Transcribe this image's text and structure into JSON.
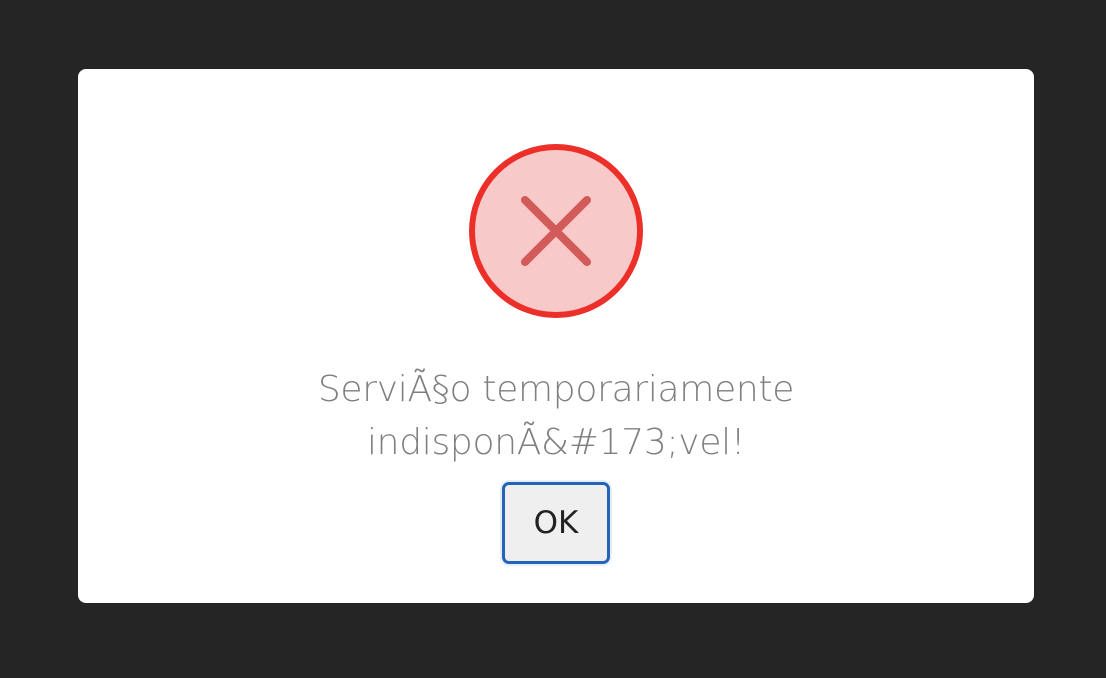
{
  "dialog": {
    "icon": "error-x-circle-icon",
    "message_line1": "ServiÃ§o temporariamente",
    "message_line2": "indisponÃ&#173;vel!",
    "ok_label": "OK"
  },
  "colors": {
    "backdrop": "#252525",
    "dialog_bg": "#ffffff",
    "icon_ring": "#ec2f28",
    "icon_fill": "#f7c9c9",
    "icon_x": "#d25a58",
    "message_text": "#7f7f7f",
    "button_border": "#2563b8",
    "button_bg": "#efefef"
  }
}
